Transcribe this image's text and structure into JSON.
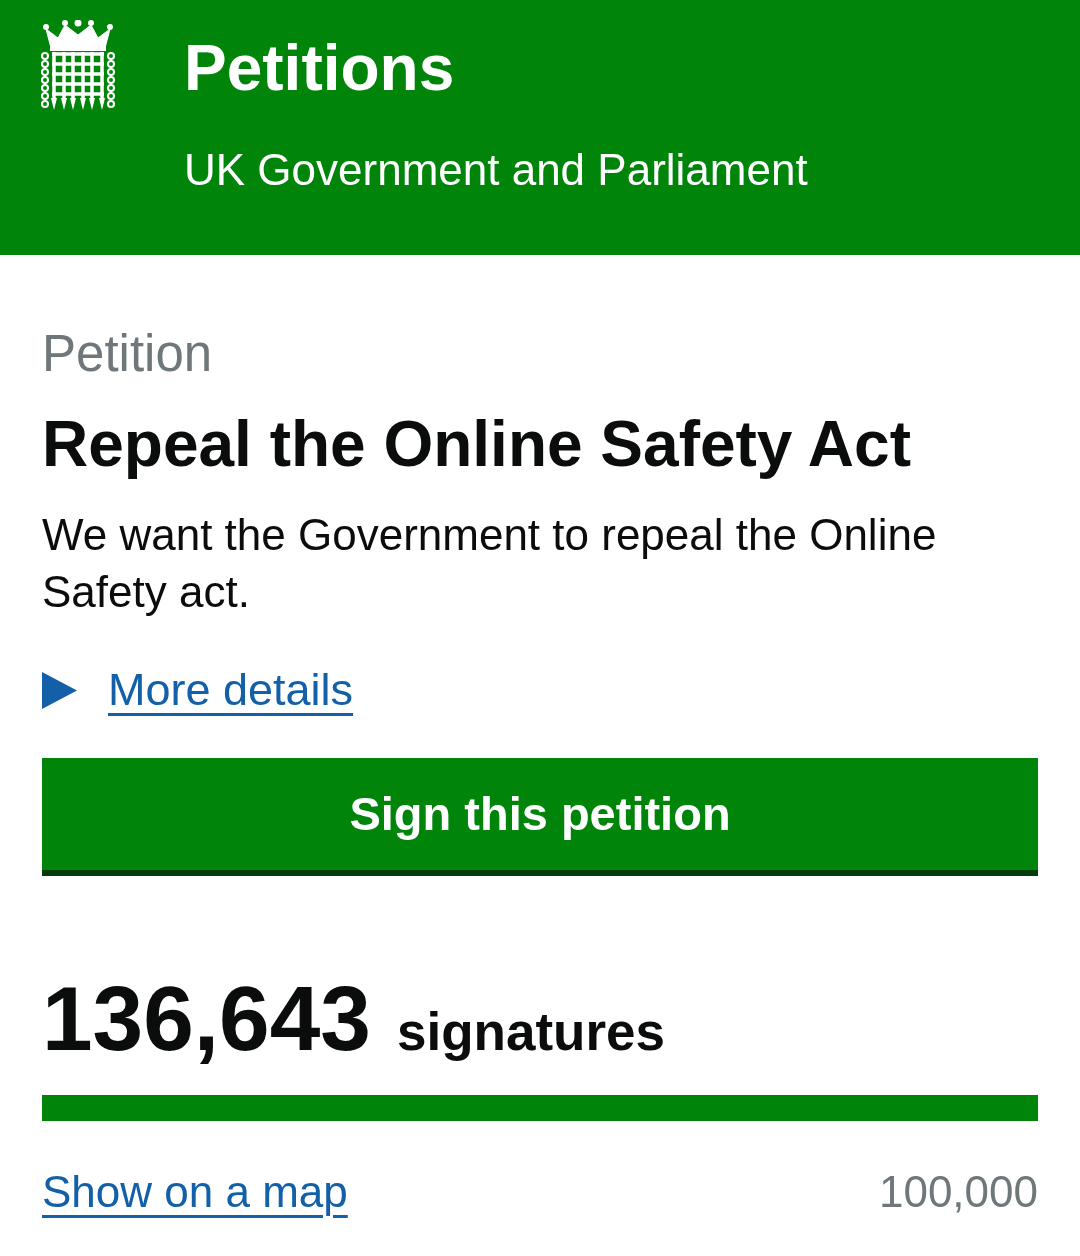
{
  "header": {
    "title": "Petitions",
    "subtitle": "UK Government and Parliament"
  },
  "petition": {
    "caption": "Petition",
    "title": "Repeal the Online Safety Act",
    "description": "We want the Government to repeal the Online Safety act.",
    "details": {
      "label": "More details",
      "expanded": false
    },
    "sign_button": "Sign this petition"
  },
  "signatures": {
    "count": "136,643",
    "label": "signatures",
    "progress": {
      "level": 1
    },
    "map_link": "Show on a map",
    "threshold": "100,000"
  }
}
